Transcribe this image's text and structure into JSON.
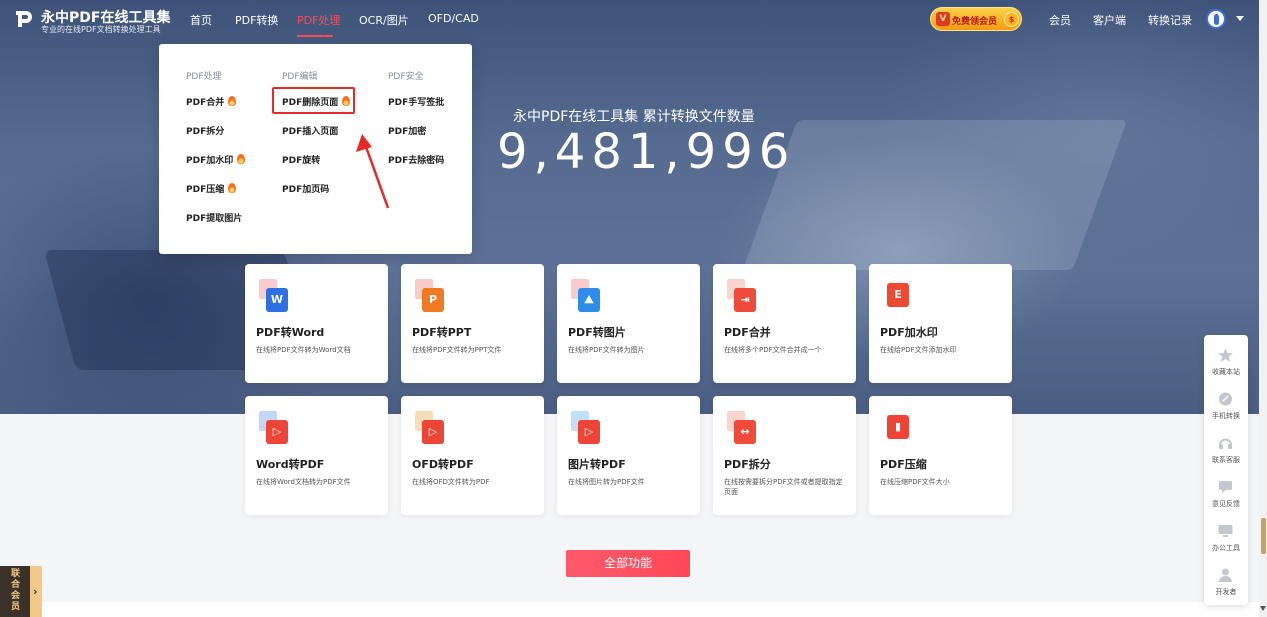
{
  "brand": {
    "title": "永中PDF在线工具集",
    "subtitle": "专业的在线PDF文档转换处理工具"
  },
  "nav": {
    "items": [
      {
        "label": "首页"
      },
      {
        "label": "PDF转换"
      },
      {
        "label": "PDF处理",
        "active": true
      },
      {
        "label": "OCR/图片"
      },
      {
        "label": "OFD/CAD"
      }
    ],
    "vip_button": "免费领会员",
    "right": [
      {
        "label": "会员"
      },
      {
        "label": "客户端"
      },
      {
        "label": "转换记录"
      }
    ]
  },
  "dropdown": {
    "columns": [
      {
        "heading": "PDF处理",
        "items": [
          {
            "label": "PDF合并",
            "hot": true
          },
          {
            "label": "PDF拆分",
            "hot": false
          },
          {
            "label": "PDF加水印",
            "hot": true
          },
          {
            "label": "PDF压缩",
            "hot": true
          },
          {
            "label": "PDF提取图片",
            "hot": false
          }
        ]
      },
      {
        "heading": "PDF编辑",
        "items": [
          {
            "label": "PDF删除页面",
            "hot": true,
            "highlighted": true
          },
          {
            "label": "PDF插入页面",
            "hot": false
          },
          {
            "label": "PDF旋转",
            "hot": false
          },
          {
            "label": "PDF加页码",
            "hot": false
          }
        ]
      },
      {
        "heading": "PDF安全",
        "items": [
          {
            "label": "PDF手写签批",
            "hot": false
          },
          {
            "label": "PDF加密",
            "hot": false
          },
          {
            "label": "PDF去除密码",
            "hot": false
          }
        ]
      }
    ]
  },
  "hero": {
    "caption": "永中PDF在线工具集  累计转换文件数量",
    "count": "9,481,996"
  },
  "tools": [
    {
      "title": "PDF转Word",
      "desc": "在线将PDF文件转为Word文档",
      "icon": "word-icon",
      "glyph": "W",
      "color": "#2f6fe4"
    },
    {
      "title": "PDF转PPT",
      "desc": "在线将PDF文件转为PPT文件",
      "icon": "ppt-icon",
      "glyph": "P",
      "color": "#f07a24"
    },
    {
      "title": "PDF转图片",
      "desc": "在线将PDF文件转为图片",
      "icon": "image-icon",
      "glyph": "⛰",
      "color": "#2d8de8"
    },
    {
      "title": "PDF合并",
      "desc": "在线将多个PDF文件合并成一个",
      "icon": "merge-icon",
      "glyph": "⇥",
      "color": "#f04b3a"
    },
    {
      "title": "PDF加水印",
      "desc": "在线给PDF文件添加水印",
      "icon": "watermark-icon",
      "glyph": "E",
      "color": "#ee4a33"
    },
    {
      "title": "Word转PDF",
      "desc": "在线将Word文档转为PDF文件",
      "icon": "pdf-icon",
      "glyph": "▷",
      "color": "#ee4435"
    },
    {
      "title": "OFD转PDF",
      "desc": "在线将OFD文件转为PDF",
      "icon": "pdf-icon",
      "glyph": "▷",
      "color": "#ee4435"
    },
    {
      "title": "图片转PDF",
      "desc": "在线将图片转为PDF文件",
      "icon": "pdf-icon",
      "glyph": "▷",
      "color": "#ee4435"
    },
    {
      "title": "PDF拆分",
      "desc": "在线按需要拆分PDF文件或者提取指定页面",
      "icon": "split-icon",
      "glyph": "↔",
      "color": "#f04b3a"
    },
    {
      "title": "PDF压缩",
      "desc": "在线压缩PDF文件大小",
      "icon": "compress-icon",
      "glyph": "▮",
      "color": "#ee4435"
    }
  ],
  "all_features": "全部功能",
  "sidebar": [
    {
      "label": "收藏本站",
      "icon": "star-icon"
    },
    {
      "label": "手机转换",
      "icon": "link-icon"
    },
    {
      "label": "联系客服",
      "icon": "headset-icon"
    },
    {
      "label": "意见反馈",
      "icon": "chat-icon"
    },
    {
      "label": "办公工具",
      "icon": "monitor-icon"
    },
    {
      "label": "开发者",
      "icon": "developer-icon"
    }
  ],
  "union_tab": "联合会员"
}
